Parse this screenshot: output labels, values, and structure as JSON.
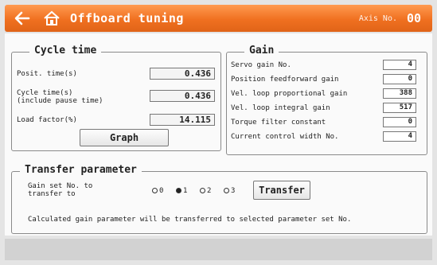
{
  "header": {
    "title": "Offboard tuning",
    "axis_label": "Axis No.",
    "axis_value": "00",
    "back_icon": "back-arrow-icon",
    "home_icon": "home-icon"
  },
  "cycle": {
    "title": "Cycle time",
    "posit_label": "Posit. time(s)",
    "posit_value": "0.436",
    "cycle_label_1": "Cycle time(s)",
    "cycle_label_2": "(include pause time)",
    "cycle_value": "0.436",
    "load_label": "Load factor(%)",
    "load_value": "14.115",
    "graph_button": "Graph"
  },
  "gain": {
    "title": "Gain",
    "rows": [
      {
        "label": "Servo gain No.",
        "value": "4"
      },
      {
        "label": "Position feedforward gain",
        "value": "0"
      },
      {
        "label": "Vel. loop proportional gain",
        "value": "388"
      },
      {
        "label": "Vel. loop integral gain",
        "value": "517"
      },
      {
        "label": "Torque filter constant",
        "value": "0"
      },
      {
        "label": "Current control width No.",
        "value": "4"
      }
    ]
  },
  "transfer": {
    "title": "Transfer parameter",
    "set_label_1": "Gain set No. to",
    "set_label_2": "transfer to",
    "options": [
      "0",
      "1",
      "2",
      "3"
    ],
    "selected": "1",
    "transfer_button": "Transfer",
    "note": "Calculated gain parameter will be transferred to selected parameter set No."
  }
}
